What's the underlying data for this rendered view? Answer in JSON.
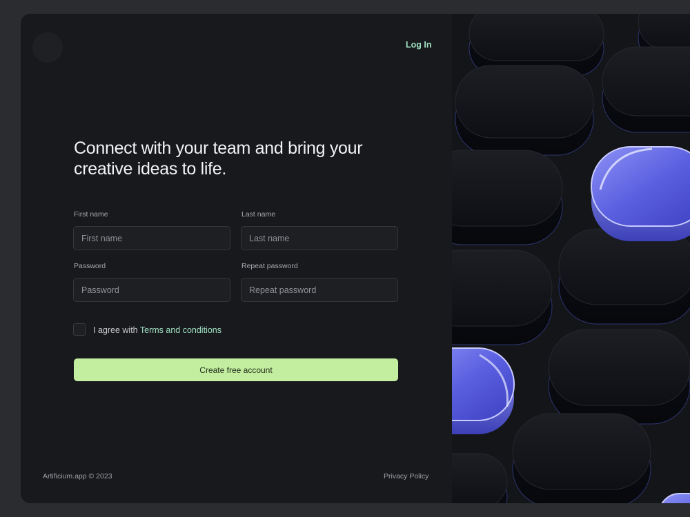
{
  "header": {
    "login_label": "Log In"
  },
  "main": {
    "headline": "Connect with your team and bring your creative ideas to life."
  },
  "form": {
    "first_name": {
      "label": "First name",
      "placeholder": "First name",
      "value": ""
    },
    "last_name": {
      "label": "Last name",
      "placeholder": "Last name",
      "value": ""
    },
    "password": {
      "label": "Password",
      "placeholder": "Password",
      "value": ""
    },
    "repeat_password": {
      "label": "Repeat password",
      "placeholder": "Repeat password",
      "value": ""
    },
    "agree_prefix": "I agree with ",
    "terms_link": "Terms and conditions",
    "agree_checked": false,
    "submit_label": "Create free account"
  },
  "footer": {
    "copyright": "Artificium.app © 2023",
    "privacy": "Privacy Policy"
  },
  "colors": {
    "accent": "#c3eea0",
    "link": "#9fe0c2",
    "background": "#18191c",
    "highlight_pill": "#6b70e8"
  },
  "icons": {
    "logo": "logo-icon",
    "checkbox": "checkbox-icon"
  }
}
